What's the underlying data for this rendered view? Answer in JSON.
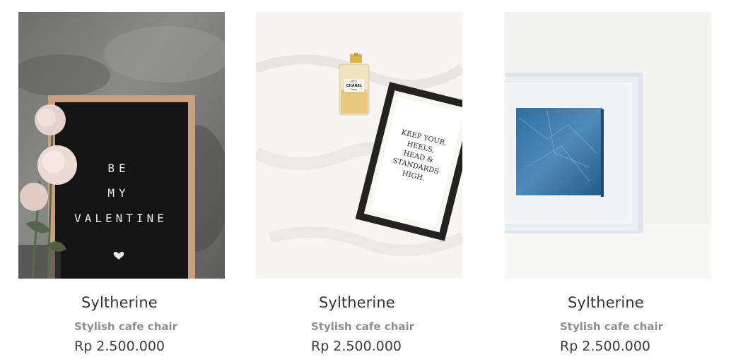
{
  "products": [
    {
      "name": "Syltherine",
      "description": "Stylish cafe chair",
      "price": "Rp 2.500.000",
      "image": {
        "letter_board_lines": [
          "BE",
          "MY",
          "VALENTINE"
        ]
      }
    },
    {
      "name": "Syltherine",
      "description": "Stylish cafe chair",
      "price": "Rp 2.500.000",
      "image": {
        "perfume_label": [
          "N°5",
          "CHANEL",
          "PARIS"
        ],
        "frame_quote_lines": [
          "KEEP YOUR",
          "HEELS,",
          "HEAD &",
          "STANDARDS",
          "HIGH."
        ]
      }
    },
    {
      "name": "Syltherine",
      "description": "Stylish cafe chair",
      "price": "Rp 2.500.000",
      "image": {}
    }
  ]
}
